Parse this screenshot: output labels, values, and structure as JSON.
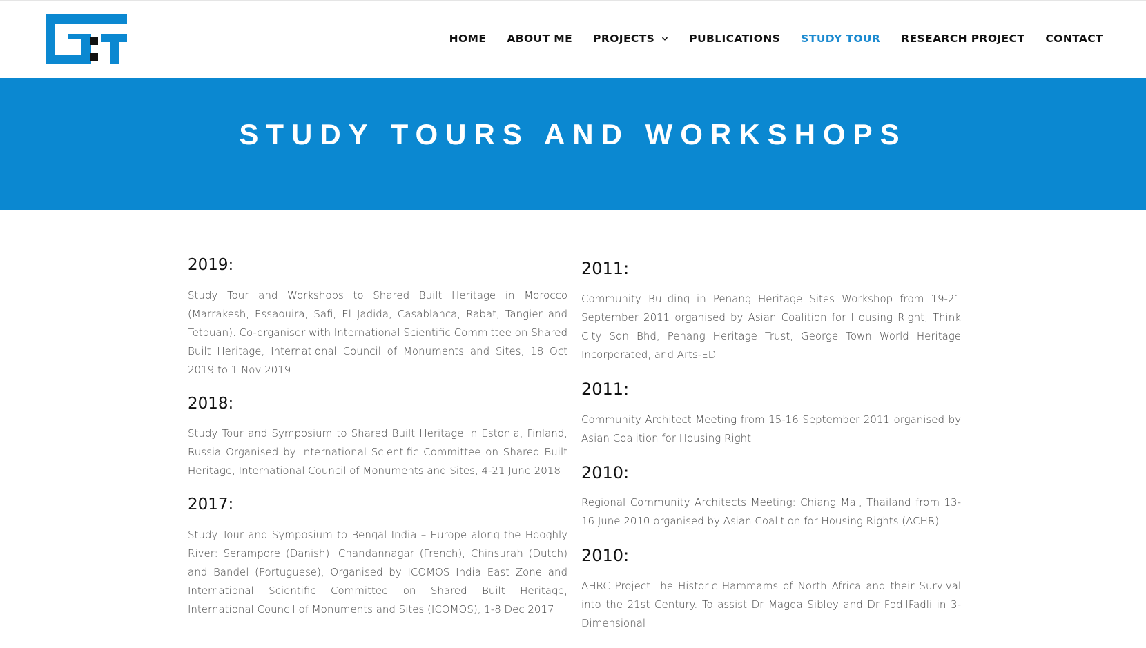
{
  "header": {
    "logo_alt": "G:T",
    "brand_color": "#0b88d1"
  },
  "nav": {
    "items": [
      {
        "label": "HOME",
        "active": false
      },
      {
        "label": "ABOUT ME",
        "active": false
      },
      {
        "label": "PROJECTS",
        "active": false,
        "has_dropdown": true
      },
      {
        "label": "PUBLICATIONS",
        "active": false
      },
      {
        "label": "STUDY TOUR",
        "active": true
      },
      {
        "label": "RESEARCH PROJECT",
        "active": false
      },
      {
        "label": "CONTACT",
        "active": false
      }
    ],
    "active_color": "#1b8ad0"
  },
  "hero": {
    "title": "STUDY TOURS AND WORKSHOPS",
    "background": "#0b88d1"
  },
  "left_column": [
    {
      "year": "2019:",
      "text": "Study Tour and Workshops to Shared Built Heritage in Morocco (Marrakesh, Essaouira, Safi, El Jadida, Casablanca, Rabat, Tangier and Tetouan). Co-organiser with International Scientific Committee on Shared Built Heritage, International Council of Monuments and Sites, 18 Oct 2019 to 1 Nov 2019."
    },
    {
      "year": "2018:",
      "text": "Study Tour and Symposium to Shared Built Heritage in Estonia, Finland, Russia Organised by International Scientific Committee on Shared Built Heritage, International Council of Monuments and Sites, 4-21 June 2018"
    },
    {
      "year": "2017:",
      "text": "Study Tour and Symposium to Bengal India – Europe along the Hooghly River: Serampore (Danish), Chandannagar (French), Chinsurah (Dutch) and Bandel (Portuguese), Organised by ICOMOS India East Zone and International Scientific Committee on Shared Built Heritage, International Council of Monuments and Sites (ICOMOS), 1-8 Dec 2017"
    }
  ],
  "right_column": [
    {
      "year": "2011:",
      "text": "Community Building in Penang Heritage Sites Workshop from 19-21 September 2011 organised by Asian Coalition for Housing Right, Think City Sdn Bhd, Penang Heritage Trust, George Town World Heritage Incorporated, and Arts-ED"
    },
    {
      "year": "2011:",
      "text": "Community Architect Meeting from 15-16 September 2011 organised by Asian Coalition for Housing Right"
    },
    {
      "year": "2010:",
      "text": "Regional Community Architects Meeting: Chiang Mai, Thailand from 13-16 June 2010 organised by Asian Coalition for Housing Rights (ACHR)"
    },
    {
      "year": "2010:",
      "text": "AHRC Project:The Historic Hammams of North Africa and their Survival into the 21st Century. To assist Dr Magda Sibley and Dr FodilFadli in 3-Dimensional"
    }
  ]
}
